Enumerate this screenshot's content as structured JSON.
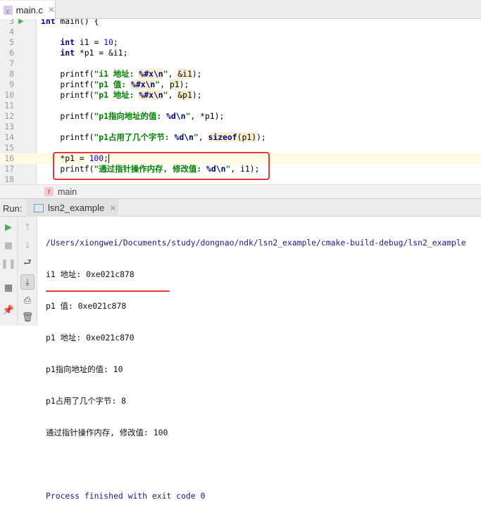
{
  "tab": {
    "filename": "main.c",
    "icon": "c-file-icon"
  },
  "code": [
    {
      "n": "3",
      "tokens": [
        {
          "t": "int",
          "c": "kw"
        },
        {
          "t": " main() {",
          "c": ""
        }
      ]
    },
    {
      "n": "4",
      "tokens": []
    },
    {
      "n": "5",
      "tokens": [
        {
          "t": "    "
        },
        {
          "t": "int",
          "c": "kw"
        },
        {
          "t": " i1 = "
        },
        {
          "t": "10",
          "c": "num"
        },
        {
          "t": ";"
        }
      ]
    },
    {
      "n": "6",
      "tokens": [
        {
          "t": "    "
        },
        {
          "t": "int",
          "c": "kw"
        },
        {
          "t": " *p1 = &i1;"
        }
      ]
    },
    {
      "n": "7",
      "tokens": []
    },
    {
      "n": "8",
      "tokens": [
        {
          "t": "    printf("
        },
        {
          "t": "\"i1 地址: ",
          "c": "str"
        },
        {
          "t": "%#x\\n",
          "c": "fmt"
        },
        {
          "t": "\"",
          "c": "str"
        },
        {
          "t": ", "
        },
        {
          "t": "&i1",
          "c": "hl"
        },
        {
          "t": ");"
        }
      ]
    },
    {
      "n": "9",
      "tokens": [
        {
          "t": "    printf("
        },
        {
          "t": "\"p1 值: ",
          "c": "str"
        },
        {
          "t": "%#x\\n",
          "c": "fmt"
        },
        {
          "t": "\"",
          "c": "str"
        },
        {
          "t": ", "
        },
        {
          "t": "p1",
          "c": "hl"
        },
        {
          "t": ");"
        }
      ]
    },
    {
      "n": "10",
      "tokens": [
        {
          "t": "    printf("
        },
        {
          "t": "\"p1 地址: ",
          "c": "str"
        },
        {
          "t": "%#x\\n",
          "c": "fmt"
        },
        {
          "t": "\"",
          "c": "str"
        },
        {
          "t": ", "
        },
        {
          "t": "&p1",
          "c": "hl"
        },
        {
          "t": ");"
        }
      ]
    },
    {
      "n": "11",
      "tokens": []
    },
    {
      "n": "12",
      "tokens": [
        {
          "t": "    printf("
        },
        {
          "t": "\"p1指向地址的值: ",
          "c": "str"
        },
        {
          "t": "%d\\n",
          "c": "kw"
        },
        {
          "t": "\"",
          "c": "str"
        },
        {
          "t": ", *p1);"
        }
      ]
    },
    {
      "n": "13",
      "tokens": []
    },
    {
      "n": "14",
      "tokens": [
        {
          "t": "    printf("
        },
        {
          "t": "\"p1占用了几个字节: ",
          "c": "str"
        },
        {
          "t": "%d\\n",
          "c": "kw"
        },
        {
          "t": "\"",
          "c": "str"
        },
        {
          "t": ", "
        },
        {
          "t": "sizeof",
          "c": "fmt"
        },
        {
          "t": "(p1)",
          "c": "hl"
        },
        {
          "t": ");"
        }
      ]
    },
    {
      "n": "15",
      "tokens": []
    },
    {
      "n": "16",
      "tokens": [
        {
          "t": "    *p1 = "
        },
        {
          "t": "100",
          "c": "num"
        },
        {
          "t": ";"
        }
      ],
      "current": true
    },
    {
      "n": "17",
      "tokens": [
        {
          "t": "    printf("
        },
        {
          "t": "\"通过指针操作内存, 修改值: ",
          "c": "str"
        },
        {
          "t": "%d\\n",
          "c": "kw"
        },
        {
          "t": "\"",
          "c": "str"
        },
        {
          "t": ", i1);"
        }
      ]
    },
    {
      "n": "18",
      "tokens": []
    }
  ],
  "breadcrumb": {
    "badge": "f",
    "label": "main"
  },
  "run": {
    "label": "Run:",
    "tab": "lsn2_example"
  },
  "console": {
    "path": "/Users/xiongwei/Documents/study/dongnao/ndk/lsn2_example/cmake-build-debug/lsn2_example",
    "lines": [
      "i1 地址: 0xe021c878",
      "p1 值: 0xe021c878",
      "p1 地址: 0xe021c870",
      "p1指向地址的值: 10",
      "p1占用了几个字节: 8",
      "通过指针操作内存, 修改值: 100"
    ],
    "exit": "Process finished with exit code 0"
  }
}
